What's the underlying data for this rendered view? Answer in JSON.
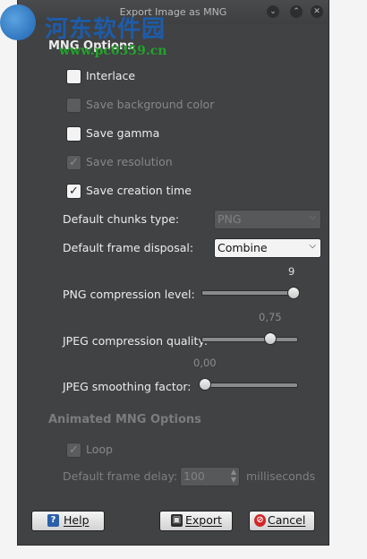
{
  "window": {
    "title": "Export Image as MNG",
    "watermark_text": "河东软件园",
    "watermark_url": "www.pc0359.cn"
  },
  "mng_options": {
    "title": "MNG Options",
    "checkboxes": [
      {
        "label": "Interlace",
        "checked": false,
        "enabled": true
      },
      {
        "label": "Save background color",
        "checked": false,
        "enabled": false
      },
      {
        "label": "Save gamma",
        "checked": false,
        "enabled": true
      },
      {
        "label": "Save resolution",
        "checked": true,
        "enabled": false
      },
      {
        "label": "Save creation time",
        "checked": true,
        "enabled": true
      }
    ],
    "chunks_type": {
      "label": "Default chunks type:",
      "value": "PNG",
      "enabled": false
    },
    "frame_disposal": {
      "label": "Default frame disposal:",
      "value": "Combine",
      "enabled": true
    },
    "png_compression": {
      "label": "PNG compression level:",
      "value": "9",
      "fraction": 1.0
    },
    "jpeg_quality": {
      "label": "JPEG compression quality:",
      "value": "0,75",
      "fraction": 0.75
    },
    "jpeg_smoothing": {
      "label": "JPEG smoothing factor:",
      "value": "0,00",
      "fraction": 0.0
    }
  },
  "animated_options": {
    "title": "Animated MNG Options",
    "loop": {
      "label": "Loop",
      "checked": true,
      "enabled": false
    },
    "frame_delay": {
      "label": "Default frame delay:",
      "value": "100",
      "unit": "milliseconds",
      "enabled": false
    }
  },
  "buttons": {
    "help": "Help",
    "export": "Export",
    "cancel": "Cancel"
  }
}
